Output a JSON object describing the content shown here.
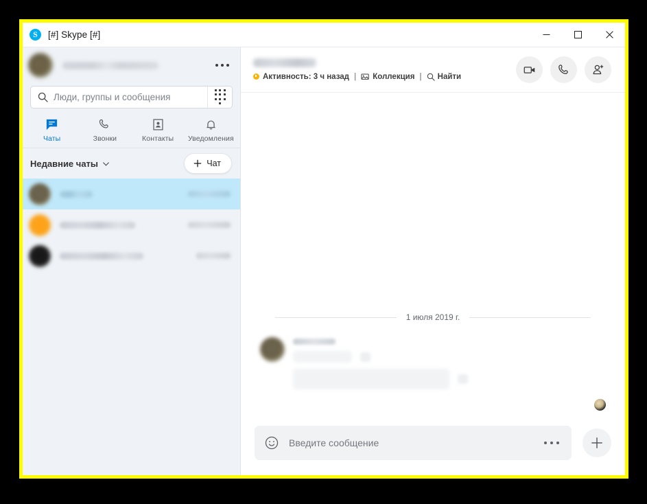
{
  "window": {
    "title": "[#] Skype [#]",
    "logo_letter": "S",
    "controls": {
      "minimize": "minimize-icon",
      "maximize": "maximize-icon",
      "close": "close-icon"
    }
  },
  "sidebar": {
    "profile": {
      "name": "",
      "menu_label": "more-options"
    },
    "search": {
      "placeholder": "Люди, группы и сообщения",
      "value": "",
      "icon": "search-icon",
      "dialpad_icon": "dialpad-icon"
    },
    "tabs": [
      {
        "label": "Чаты",
        "icon": "chat-icon",
        "active": true
      },
      {
        "label": "Звонки",
        "icon": "phone-icon",
        "active": false
      },
      {
        "label": "Контакты",
        "icon": "contacts-icon",
        "active": false
      },
      {
        "label": "Уведомления",
        "icon": "bell-icon",
        "active": false
      }
    ],
    "recent": {
      "title": "Недавние чаты",
      "chevron_icon": "chevron-down-icon",
      "new_chat_label": "Чат",
      "new_chat_icon": "plus-icon"
    },
    "chats": [
      {
        "name": "",
        "time": "",
        "selected": true
      },
      {
        "name": "",
        "time": "",
        "selected": false
      },
      {
        "name": "",
        "time": "",
        "selected": false
      }
    ]
  },
  "chat": {
    "header": {
      "title": "",
      "status_icon": "away-status-dot",
      "activity": "Активность: 3 ч назад",
      "separator": "|",
      "gallery": "Коллекция",
      "gallery_icon": "gallery-icon",
      "find": "Найти",
      "find_icon": "search-icon",
      "actions": [
        {
          "name": "video-call-button",
          "icon": "video-camera-icon"
        },
        {
          "name": "audio-call-button",
          "icon": "phone-icon"
        },
        {
          "name": "add-people-button",
          "icon": "add-person-icon"
        }
      ]
    },
    "date_divider": "1 июля 2019 г.",
    "messages": [
      {
        "sender": "",
        "text": "",
        "time": ""
      },
      {
        "sender": "",
        "text": "",
        "time": ""
      }
    ],
    "composer": {
      "placeholder": "Введите сообщение",
      "value": "",
      "emoji_icon": "emoji-icon",
      "more_icon": "ellipsis-icon",
      "add_icon": "plus-icon"
    }
  },
  "colors": {
    "accent": "#0078d4",
    "skype_blue": "#00aff0",
    "highlight_border": "#fffb00",
    "selected_chat": "#bfe8fa",
    "status_away": "#f5b50a",
    "sidebar_bg": "#eff2f6",
    "backdrop": "#000000"
  }
}
